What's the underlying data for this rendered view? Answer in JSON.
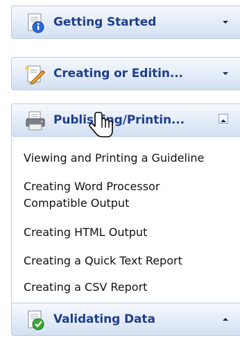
{
  "sections": [
    {
      "title": "Getting Started",
      "chevron": "chevron-down-icon",
      "icon": "info-document-icon"
    },
    {
      "title": "Creating or Editin...",
      "chevron": "chevron-down-icon",
      "icon": "edit-document-icon"
    },
    {
      "title": "Publishing/Printin...",
      "chevron": "chevron-up-box-icon",
      "icon": "printer-icon",
      "expanded": true
    },
    {
      "title": "Validating Data",
      "chevron": "chevron-up-icon",
      "icon": "check-document-icon"
    }
  ],
  "publishing_items": [
    "Viewing and Printing a Guideline",
    "Creating Word Processor",
    "Compatible Output",
    "Creating HTML Output",
    "Creating a Quick Text Report",
    "Creating a CSV Report"
  ],
  "colors": {
    "header_text": "#1f3f8c",
    "header_gradient_top": "#f6f9fd",
    "header_gradient_bottom": "#d3e0f2",
    "header_border": "#b8cbe6",
    "item_text": "#111111"
  },
  "cursor": "hand-pointer-icon"
}
